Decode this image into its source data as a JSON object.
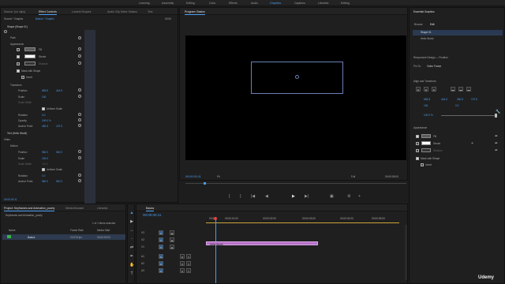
{
  "workspaces": [
    "Learning",
    "Assembly",
    "Editing",
    "Color",
    "Effects",
    "Audio",
    "Graphics",
    "Captions",
    "Libraries",
    "Editing"
  ],
  "active_workspace_index": 6,
  "left_panel": {
    "tabs": [
      "Source: (no clips)",
      "Effect Controls",
      "Lumetri Scopes",
      "Audio Clip Mixer: Basics",
      "Text"
    ],
    "active_tab_index": 1,
    "source_label": "Source * Graphic",
    "sequence_label": "Basics * Graphic",
    "timecode_right": "00:00",
    "shape_title": "Shape (Shape 01)",
    "rows": {
      "path": "Path",
      "appearance": "Appearance",
      "fill": "Fill",
      "stroke": "Stroke",
      "shadow": "Shadow",
      "mask_with_shape": "Mask with Shape",
      "invert": "Invert",
      "transform": "Transform",
      "position": "Position",
      "position_x": "683.8",
      "position_y": "444.5",
      "scale": "Scale",
      "scale_val": "100",
      "scale_width": "Scale Width",
      "uniform_scale": "Uniform Scale",
      "rotation": "Rotation",
      "rotation_val": "0.0",
      "opacity": "Opacity",
      "opacity_val": "100.0 %",
      "anchor_point": "Anchor Point",
      "anchor_x": "460.5",
      "anchor_y": "137.5",
      "text_title": "Text (Hello World)",
      "video": "Video",
      "motion": "Motion",
      "m_position": "Position",
      "m_pos_x": "960.0",
      "m_pos_y": "540.0",
      "m_scale": "Scale",
      "m_scale_val": "100.0",
      "m_scale_width": "Scale Width",
      "m_scale_width_val": "100.0",
      "m_uniform": "Uniform Scale",
      "m_rotation": "Rotation",
      "m_rotation_val": "0.0",
      "m_anchor": "Anchor Point",
      "m_anchor_x": "960.0",
      "m_anchor_y": "540.0"
    },
    "bottom_timecode": "00:00:00:11"
  },
  "program": {
    "title": "Program: Basics",
    "timecode": "00:00:00:11",
    "fit": "Fit",
    "quality": "Full",
    "duration": "00:00:05:00"
  },
  "project": {
    "tabs": [
      "Project: Keyframes and Animation_poorly",
      "Media Browser",
      "Libraries"
    ],
    "project_name": "Keyframes and Animation_poorly",
    "selection_info": "1 of 1 items selected",
    "columns": [
      "Name",
      "Frame Rate",
      "Media Start"
    ],
    "items": [
      {
        "name": "Basics",
        "frame_rate": "23.976 fps",
        "media_start": "00:00:00:00"
      }
    ]
  },
  "timeline": {
    "title": "Basics",
    "timecode": "00:00:00:11",
    "ruler": [
      "00:00",
      "00:00:01:00",
      "00:00:02:00",
      "00:00:03:00",
      "00:00:04:00",
      "00:00:05:00"
    ],
    "tracks": [
      "V3",
      "V2",
      "V1",
      "A1",
      "A2",
      "A3"
    ],
    "clip_label": "Hello World"
  },
  "essential_graphics": {
    "title": "Essential Graphics",
    "tabs": [
      "Browse",
      "Edit"
    ],
    "active_tab_index": 1,
    "layers": [
      "Shape 01",
      "Hello World"
    ],
    "responsive_label": "Responsive Design — Position",
    "pin_to": "Pin To:",
    "pin_target": "Video Frame",
    "align_label": "Align and Transform",
    "pos_x": "683.8",
    "pos_y": "444.5",
    "scale_val": "100",
    "rotation_val": "0.0",
    "anchor_x": "460.5",
    "anchor_y": "137.5",
    "opacity_val": "100.0 %",
    "appearance_label": "Appearance",
    "fill": "Fill",
    "stroke": "Stroke",
    "shadow": "Shadow",
    "mask_with_shape": "Mask with Shape",
    "invert": "Invert"
  },
  "watermark": "Udemy",
  "colors": {
    "accent": "#4b9cf0",
    "clip": "#b672c9",
    "bg": "#1d1d1d"
  }
}
